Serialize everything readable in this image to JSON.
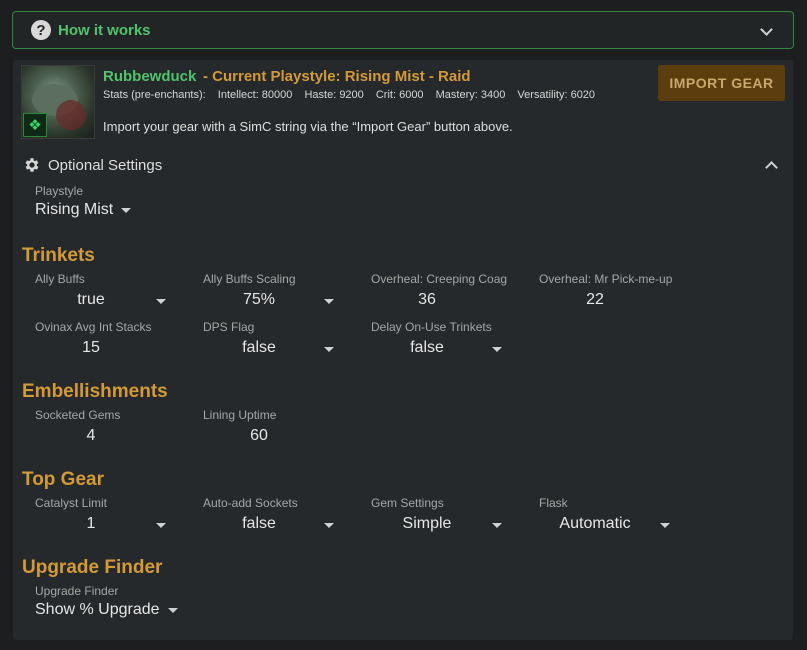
{
  "how_it_works": {
    "label": "How it works",
    "icon": "question-circle-icon"
  },
  "character": {
    "name": "Rubbewduck",
    "playstyle_title": "- Current Playstyle: Rising Mist - Raid",
    "stats": {
      "prefix": "Stats (pre-enchants):",
      "intellect": "Intellect: 80000",
      "haste": "Haste: 9200",
      "crit": "Crit: 6000",
      "mastery": "Mastery: 3400",
      "versatility": "Versatility: 6020"
    },
    "import_note": "Import your gear with a SimC string via the “Import Gear” button above.",
    "import_button": "IMPORT GEAR"
  },
  "optional_settings": {
    "label": "Optional Settings",
    "playstyle": {
      "label": "Playstyle",
      "value": "Rising Mist"
    }
  },
  "sections": {
    "trinkets": {
      "title": "Trinkets",
      "fields": [
        {
          "label": "Ally Buffs",
          "value": "true",
          "dropdown": true
        },
        {
          "label": "Ally Buffs Scaling",
          "value": "75%",
          "dropdown": true
        },
        {
          "label": "Overheal: Creeping Coag",
          "value": "36",
          "dropdown": false
        },
        {
          "label": "Overheal: Mr Pick-me-up",
          "value": "22",
          "dropdown": false
        },
        {
          "label": "Ovinax Avg Int Stacks",
          "value": "15",
          "dropdown": false
        },
        {
          "label": "DPS Flag",
          "value": "false",
          "dropdown": true
        },
        {
          "label": "Delay On-Use Trinkets",
          "value": "false",
          "dropdown": true
        }
      ]
    },
    "embellishments": {
      "title": "Embellishments",
      "fields": [
        {
          "label": "Socketed Gems",
          "value": "4",
          "dropdown": false
        },
        {
          "label": "Lining Uptime",
          "value": "60",
          "dropdown": false
        }
      ]
    },
    "top_gear": {
      "title": "Top Gear",
      "fields": [
        {
          "label": "Catalyst Limit",
          "value": "1",
          "dropdown": true
        },
        {
          "label": "Auto-add Sockets",
          "value": "false",
          "dropdown": true
        },
        {
          "label": "Gem Settings",
          "value": "Simple",
          "dropdown": true
        },
        {
          "label": "Flask",
          "value": "Automatic",
          "dropdown": true
        }
      ]
    },
    "upgrade_finder": {
      "title": "Upgrade Finder",
      "field": {
        "label": "Upgrade Finder",
        "value": "Show % Upgrade"
      }
    }
  },
  "colors": {
    "accent_green": "#4fc46a",
    "accent_gold": "#d39a35",
    "button_bg": "#5c3e0e",
    "panel_bg": "#25292b",
    "page_bg": "#1c1e1f"
  }
}
